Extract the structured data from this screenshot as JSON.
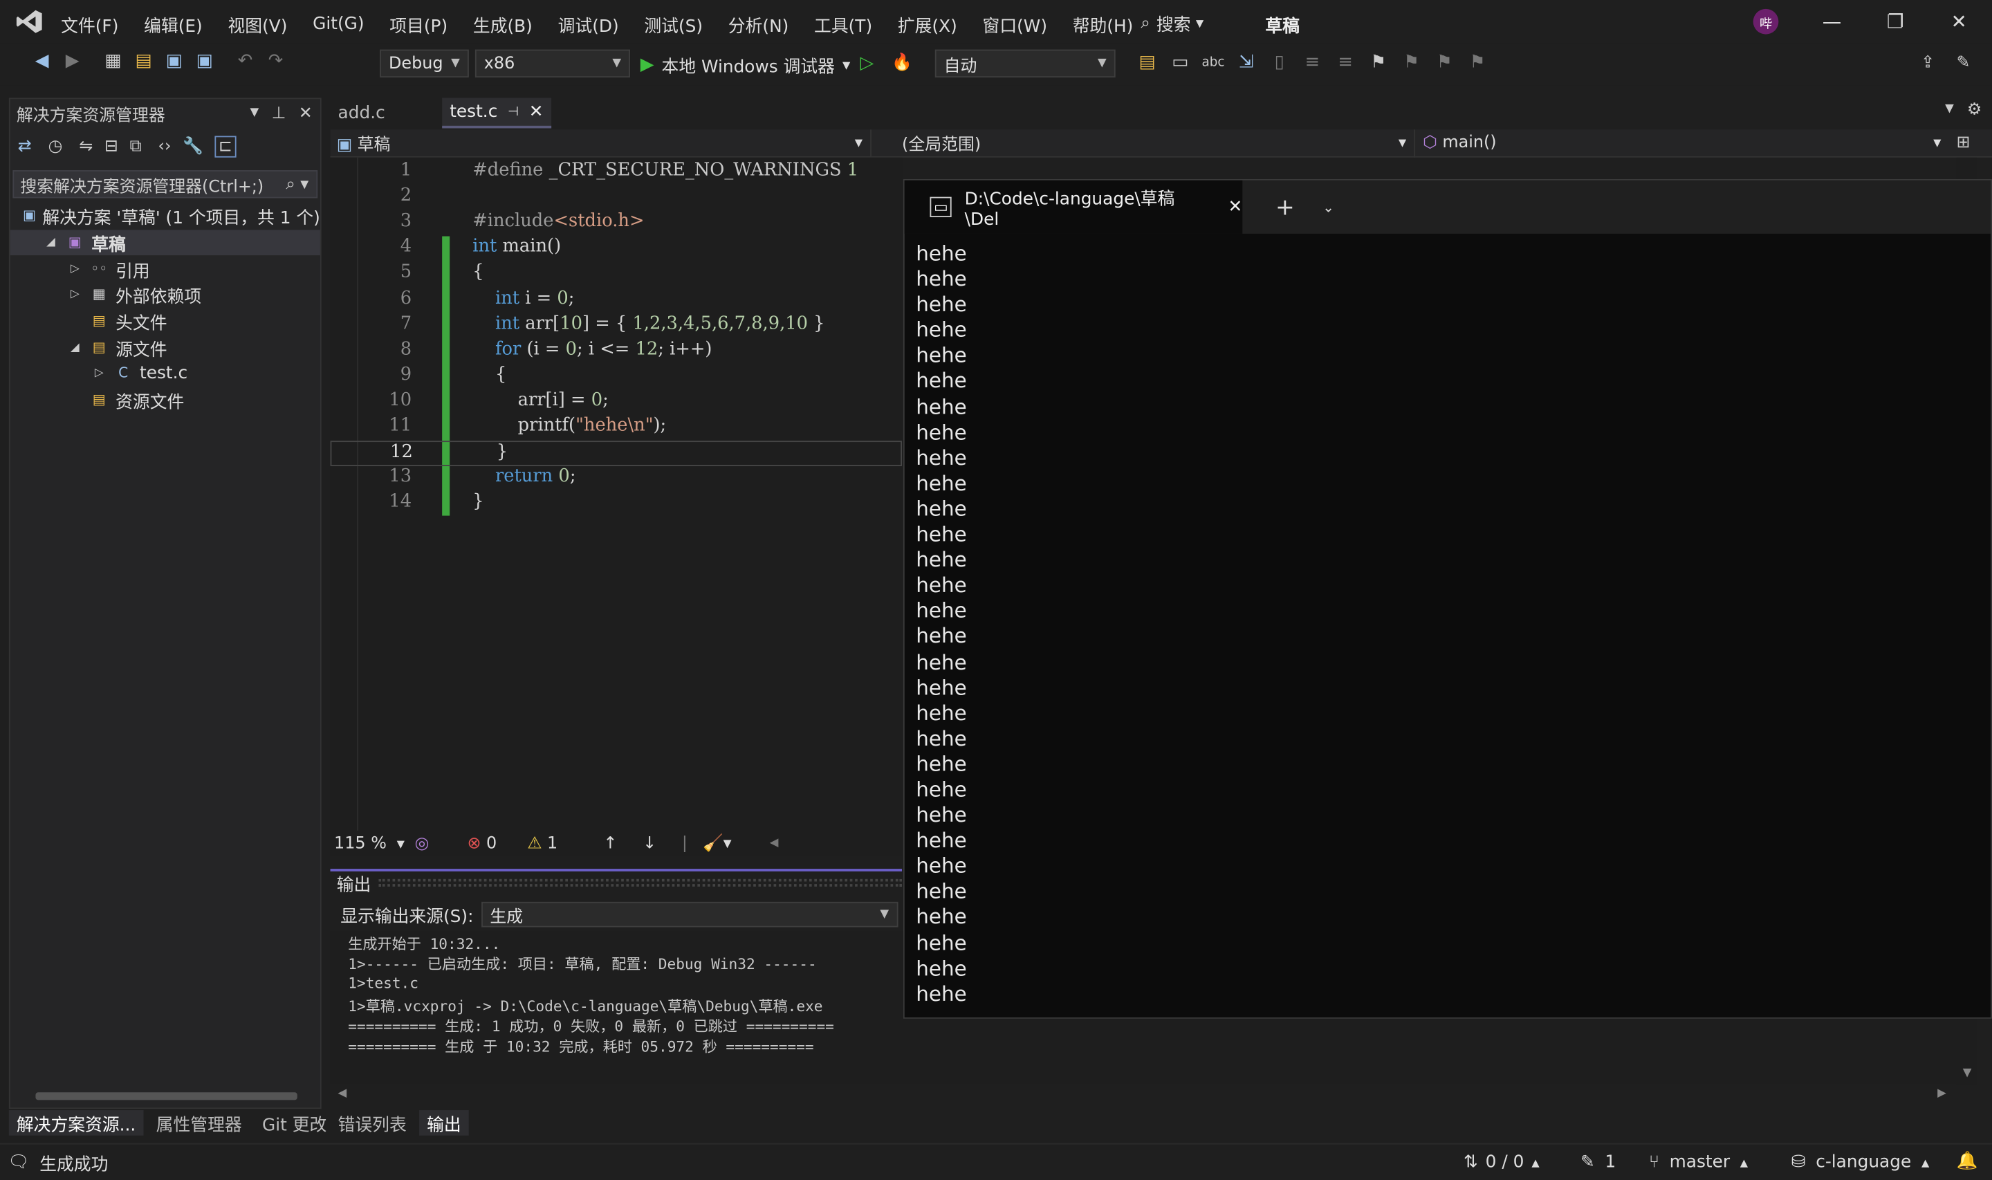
{
  "menu": [
    "文件(F)",
    "编辑(E)",
    "视图(V)",
    "Git(G)",
    "项目(P)",
    "生成(B)",
    "调试(D)",
    "测试(S)",
    "分析(N)",
    "工具(T)",
    "扩展(X)",
    "窗口(W)",
    "帮助(H)"
  ],
  "search_label": "搜索",
  "solution_title": "草稿",
  "avatar_text": "哔",
  "toolbar": {
    "config": "Debug",
    "platform": "x86",
    "run_label": "本地 Windows 调试器",
    "auto": "自动"
  },
  "solution_explorer": {
    "title": "解决方案资源管理器",
    "search_placeholder": "搜索解决方案资源管理器(Ctrl+;)",
    "tree": [
      {
        "label": "解决方案 '草稿' (1 个项目，共 1 个)",
        "indent": 0
      },
      {
        "label": "草稿",
        "indent": 1
      },
      {
        "label": "引用",
        "indent": 2
      },
      {
        "label": "外部依赖项",
        "indent": 2
      },
      {
        "label": "头文件",
        "indent": 2
      },
      {
        "label": "源文件",
        "indent": 2
      },
      {
        "label": "test.c",
        "indent": 3
      },
      {
        "label": "资源文件",
        "indent": 2
      }
    ],
    "bottom_tabs": [
      "解决方案资源...",
      "属性管理器",
      "Git 更改"
    ]
  },
  "editor": {
    "tabs": [
      "add.c",
      "test.c"
    ],
    "nav_project": "草稿",
    "nav_scope": "(全局范围)",
    "nav_member": "main()",
    "zoom": "115 %",
    "errors": "0",
    "warnings": "1",
    "current_line": 12,
    "lines": [
      {
        "n": "1",
        "html": "<span class='pp'>#define </span><span class='id'>_CRT_SECURE_NO_WARNINGS</span><span class='num'> 1</span>"
      },
      {
        "n": "2",
        "html": ""
      },
      {
        "n": "3",
        "html": "<span class='pp'>#include</span><span class='str'>&lt;stdio.h&gt;</span>"
      },
      {
        "n": "4",
        "html": "<span class='kw'>int</span><span class='fn'> main()</span>"
      },
      {
        "n": "5",
        "html": "<span class='fn'>{</span>"
      },
      {
        "n": "6",
        "html": "<span class='fn'>    </span><span class='kw'>int</span><span class='fn'> i = </span><span class='num'>0</span><span class='fn'>;</span>"
      },
      {
        "n": "7",
        "html": "<span class='fn'>    </span><span class='kw'>int</span><span class='fn'> arr[</span><span class='num'>10</span><span class='fn'>] = { </span><span class='num'>1,2,3,4,5,6,7,8,9,10</span><span class='fn'> }</span>"
      },
      {
        "n": "8",
        "html": "<span class='fn'>    </span><span class='kw'>for</span><span class='fn'> (i = </span><span class='num'>0</span><span class='fn'>; i &lt;= </span><span class='num'>12</span><span class='fn'>; i++)</span>"
      },
      {
        "n": "9",
        "html": "<span class='fn'>    {</span>"
      },
      {
        "n": "10",
        "html": "<span class='fn'>        arr[i] = </span><span class='num'>0</span><span class='fn'>;</span>"
      },
      {
        "n": "11",
        "html": "<span class='fn'>        printf(</span><span class='str'>\"hehe\\n\"</span><span class='fn'>);</span>"
      },
      {
        "n": "12",
        "html": "<span class='fn'>    }</span>"
      },
      {
        "n": "13",
        "html": "<span class='fn'>    </span><span class='kw'>return</span><span class='fn'> </span><span class='num'>0</span><span class='fn'>;</span>"
      },
      {
        "n": "14",
        "html": "<span class='fn'>}</span>"
      }
    ]
  },
  "output": {
    "title": "输出",
    "source_label": "显示输出来源(S):",
    "source_value": "生成",
    "lines": [
      "生成开始于 10:32...",
      "1>------ 已启动生成: 项目: 草稿, 配置: Debug Win32 ------",
      "1>test.c",
      "1>草稿.vcxproj -> D:\\Code\\c-language\\草稿\\Debug\\草稿.exe",
      "========== 生成: 1 成功，0 失败，0 最新，0 已跳过 ==========",
      "========== 生成 于 10:32 完成，耗时 05.972 秒 =========="
    ],
    "bottom_tabs": [
      "错误列表",
      "输出"
    ]
  },
  "terminal": {
    "tab_title": "D:\\Code\\c-language\\草稿\\Del",
    "output_line": "hehe",
    "output_count": 30
  },
  "statusbar": {
    "status": "生成成功",
    "changes": "0 / 0",
    "pencil_count": "1",
    "branch": "master",
    "repo": "c-language"
  }
}
